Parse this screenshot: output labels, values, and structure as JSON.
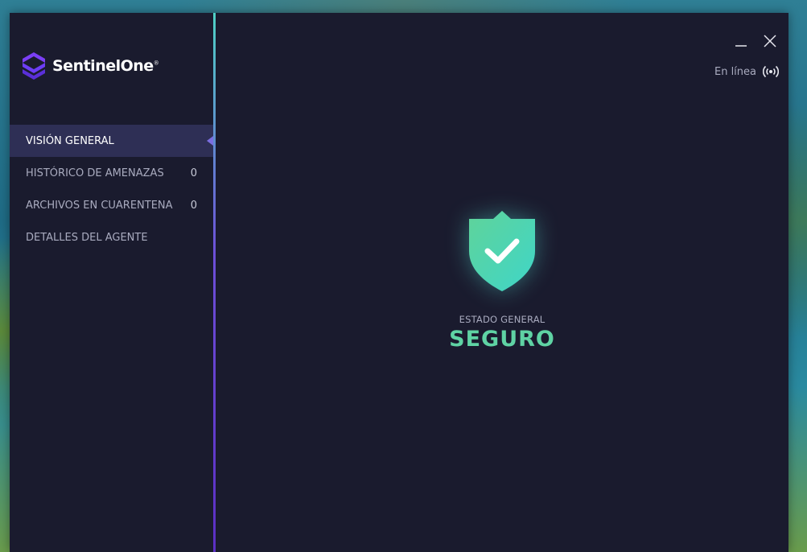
{
  "brand": {
    "name": "SentinelOne",
    "reg_mark": "®"
  },
  "nav": {
    "items": [
      {
        "label": "VISIÓN GENERAL",
        "count": ""
      },
      {
        "label": "HISTÓRICO DE AMENAZAS",
        "count": "0"
      },
      {
        "label": "ARCHIVOS EN CUARENTENA",
        "count": "0"
      },
      {
        "label": "DETALLES DEL AGENTE",
        "count": ""
      }
    ]
  },
  "connection": {
    "label": "En línea",
    "icon": "signal-broadcast-icon"
  },
  "status": {
    "label": "ESTADO GENERAL",
    "value": "SEGURO",
    "icon": "shield-check-icon"
  },
  "window_controls": {
    "minimize_icon": "minimize-icon",
    "close_icon": "close-icon"
  },
  "colors": {
    "background": "#1a1b2e",
    "accent": "#5fd3a4",
    "active_nav": "#2e2f55",
    "brand_purple": "#6d3df5"
  }
}
